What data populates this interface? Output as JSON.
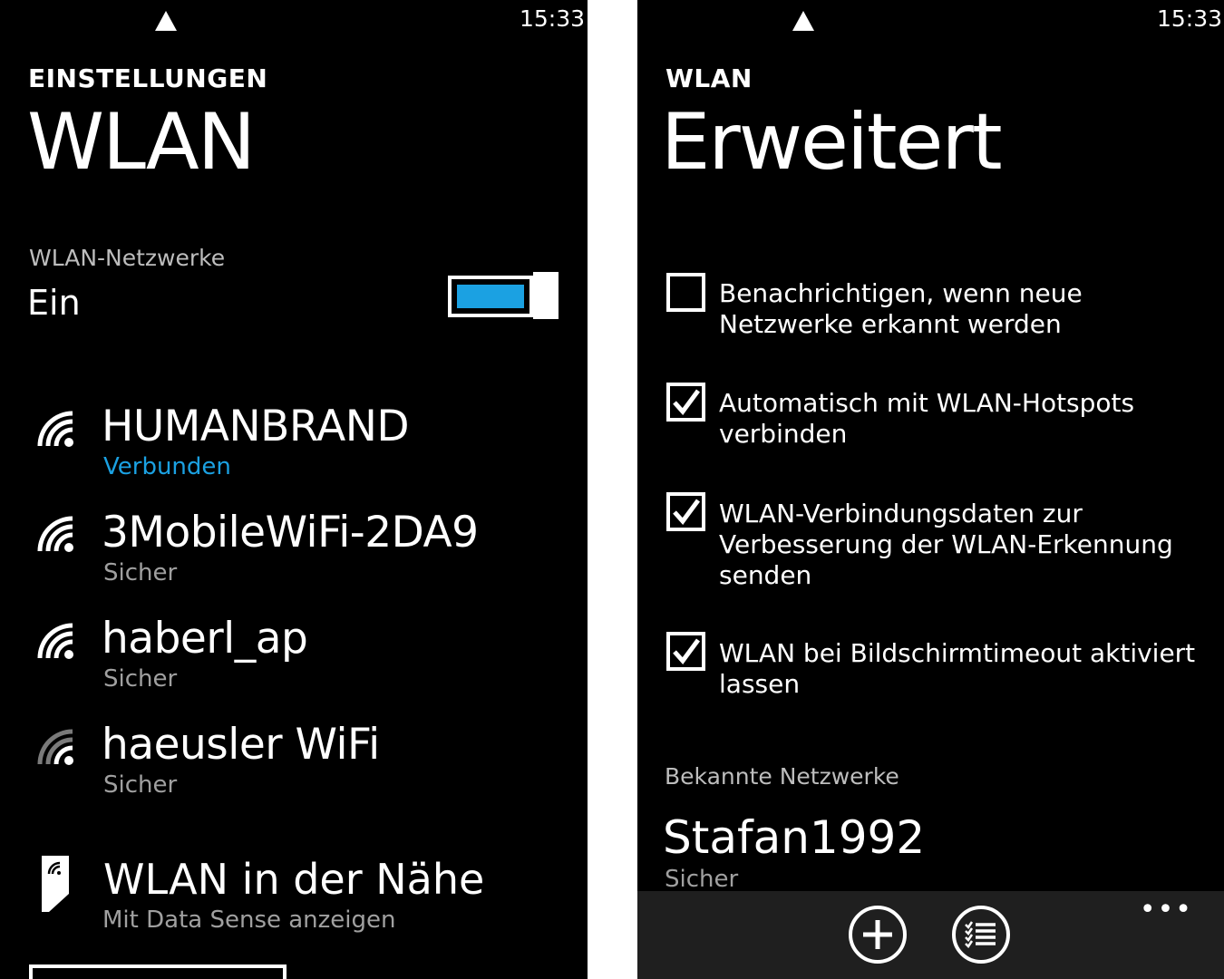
{
  "left": {
    "status": {
      "time": "15:33"
    },
    "header": {
      "kicker": "EINSTELLUNGEN",
      "title": "WLAN"
    },
    "wifi_toggle": {
      "label": "WLAN-Netzwerke",
      "state": "Ein",
      "on": true,
      "accent": "#1ba1e2"
    },
    "networks": [
      {
        "name": "HUMANBRAND",
        "status": "Verbunden",
        "icon": "wifi-signal-icon",
        "connected": true
      },
      {
        "name": "3MobileWiFi-2DA9",
        "status": "Sicher",
        "icon": "wifi-signal-icon"
      },
      {
        "name": "haberl_ap",
        "status": "Sicher",
        "icon": "wifi-signal-icon"
      },
      {
        "name": "haeusler WiFi",
        "status": "Sicher",
        "icon": "wifi-signal-weak-icon"
      }
    ],
    "nearby": {
      "label": "WLAN in der Nähe",
      "sub": "Mit Data Sense anzeigen",
      "icon": "data-sense-tile-icon"
    }
  },
  "right": {
    "status": {
      "time": "15:33"
    },
    "header": {
      "kicker": "WLAN",
      "title": "Erweitert"
    },
    "options": [
      {
        "label": "Benachrichtigen, wenn neue Netzwerke erkannt werden",
        "checked": false
      },
      {
        "label": "Automatisch mit WLAN-Hotspots verbinden",
        "checked": true
      },
      {
        "label": "WLAN-Verbindungsdaten zur Verbesserung der WLAN-Erkennung senden",
        "checked": true
      },
      {
        "label": "WLAN bei Bildschirmtimeout aktiviert lassen",
        "checked": true
      }
    ],
    "known": {
      "label": "Bekannte Netzwerke",
      "networks": [
        {
          "name": "Stafan1992",
          "status": "Sicher"
        }
      ]
    },
    "appbar": {
      "buttons": [
        "add-icon",
        "list-select-icon"
      ],
      "more": "•••"
    }
  }
}
